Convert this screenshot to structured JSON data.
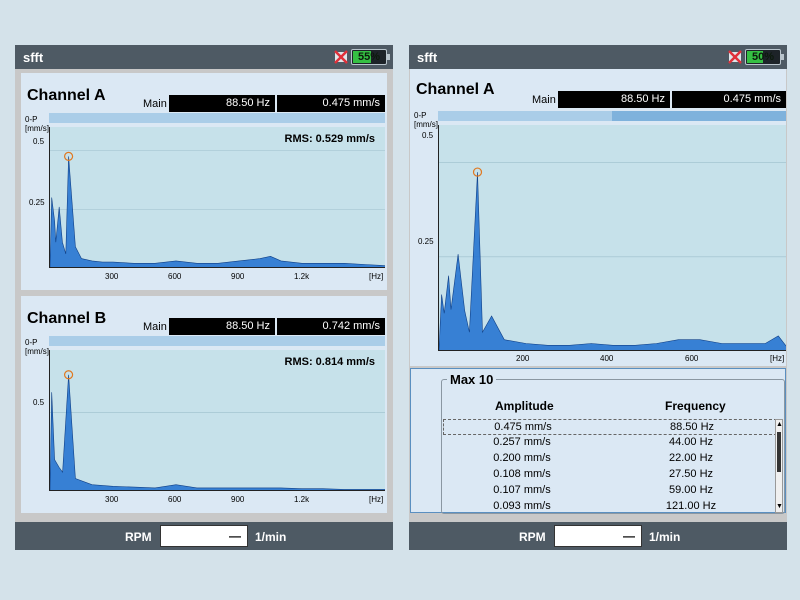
{
  "colors": {
    "bar": "#4e5a64",
    "panel": "#dbe8f4",
    "plot": "#c6e1ea",
    "spectrum": "#1d6fd0",
    "battery": "#35c043"
  },
  "left": {
    "title": "sfft",
    "battery": {
      "label": "55%",
      "level": 55
    },
    "channels": [
      {
        "name": "Channel A",
        "main_label": "Main",
        "freq": "88.50 Hz",
        "amp": "0.475 mm/s",
        "unit_top": "0-P",
        "unit": "[mm/s]",
        "rms": "RMS: 0.529 mm/s",
        "level": 1.0
      },
      {
        "name": "Channel B",
        "main_label": "Main",
        "freq": "88.50 Hz",
        "amp": "0.742 mm/s",
        "unit_top": "0-P",
        "unit": "[mm/s]",
        "rms": "RMS: 0.814 mm/s",
        "level": 1.0
      }
    ],
    "rpm": {
      "label": "RPM",
      "value": "—",
      "unit": "1/min"
    }
  },
  "right": {
    "title": "sfft",
    "battery": {
      "label": "50%",
      "level": 50
    },
    "channel": {
      "name": "Channel A",
      "main_label": "Main",
      "freq": "88.50 Hz",
      "amp": "0.475 mm/s",
      "unit_top": "0-P",
      "unit": "[mm/s]",
      "level": 0.5
    },
    "max10": {
      "title": "Max 10",
      "headers": [
        "Amplitude",
        "Frequency"
      ],
      "rows": [
        {
          "amp": "0.475 mm/s",
          "freq": "88.50 Hz"
        },
        {
          "amp": "0.257 mm/s",
          "freq": "44.00 Hz"
        },
        {
          "amp": "0.200 mm/s",
          "freq": "22.00 Hz"
        },
        {
          "amp": "0.108 mm/s",
          "freq": "27.50 Hz"
        },
        {
          "amp": "0.107 mm/s",
          "freq": "59.00 Hz"
        },
        {
          "amp": "0.093 mm/s",
          "freq": "121.00 Hz"
        }
      ]
    },
    "rpm": {
      "label": "RPM",
      "value": "—",
      "unit": "1/min"
    }
  },
  "chart_data": [
    {
      "type": "line",
      "xunit": "[Hz]",
      "xticks": [
        "300",
        "600",
        "900",
        "1.2k"
      ],
      "yticks": [
        "0.5",
        "0.25"
      ],
      "xlim": [
        0,
        1600
      ],
      "ylim": [
        0,
        0.6
      ],
      "x": [
        0,
        8,
        22,
        27.5,
        44,
        59,
        75,
        88.5,
        121,
        150,
        200,
        250,
        300,
        400,
        500,
        600,
        700,
        800,
        900,
        1000,
        1050,
        1100,
        1200,
        1300,
        1400,
        1500,
        1600
      ],
      "y": [
        0,
        0.3,
        0.2,
        0.11,
        0.26,
        0.11,
        0.06,
        0.475,
        0.09,
        0.04,
        0.03,
        0.025,
        0.025,
        0.02,
        0.02,
        0.03,
        0.02,
        0.02,
        0.03,
        0.04,
        0.05,
        0.03,
        0.02,
        0.02,
        0.02,
        0.015,
        0.01
      ]
    },
    {
      "type": "line",
      "xunit": "[Hz]",
      "xticks": [
        "300",
        "600",
        "900",
        "1.2k"
      ],
      "yticks": [
        "0.5"
      ],
      "xlim": [
        0,
        1600
      ],
      "ylim": [
        0,
        0.9
      ],
      "x": [
        0,
        8,
        22,
        44,
        60,
        88.5,
        121,
        200,
        300,
        400,
        500,
        600,
        700,
        800,
        900,
        1000,
        1100,
        1200,
        1300,
        1400,
        1500,
        1600
      ],
      "y": [
        0,
        0.63,
        0.2,
        0.15,
        0.12,
        0.742,
        0.08,
        0.04,
        0.03,
        0.025,
        0.02,
        0.04,
        0.02,
        0.02,
        0.02,
        0.02,
        0.02,
        0.015,
        0.015,
        0.01,
        0.01,
        0.01
      ]
    },
    {
      "type": "line",
      "xunit": "[Hz]",
      "xticks": [
        "200",
        "400",
        "600"
      ],
      "yticks": [
        "0.5",
        "0.25"
      ],
      "xlim": [
        0,
        800
      ],
      "ylim": [
        0,
        0.6
      ],
      "x": [
        0,
        6,
        12,
        22,
        27.5,
        44,
        59,
        70,
        88.5,
        100,
        121,
        150,
        200,
        250,
        300,
        350,
        400,
        450,
        500,
        550,
        600,
        650,
        700,
        750,
        780,
        800
      ],
      "y": [
        0,
        0.15,
        0.1,
        0.2,
        0.11,
        0.257,
        0.107,
        0.05,
        0.475,
        0.05,
        0.093,
        0.03,
        0.02,
        0.015,
        0.015,
        0.02,
        0.015,
        0.015,
        0.02,
        0.03,
        0.03,
        0.02,
        0.02,
        0.02,
        0.04,
        0.01
      ]
    }
  ]
}
